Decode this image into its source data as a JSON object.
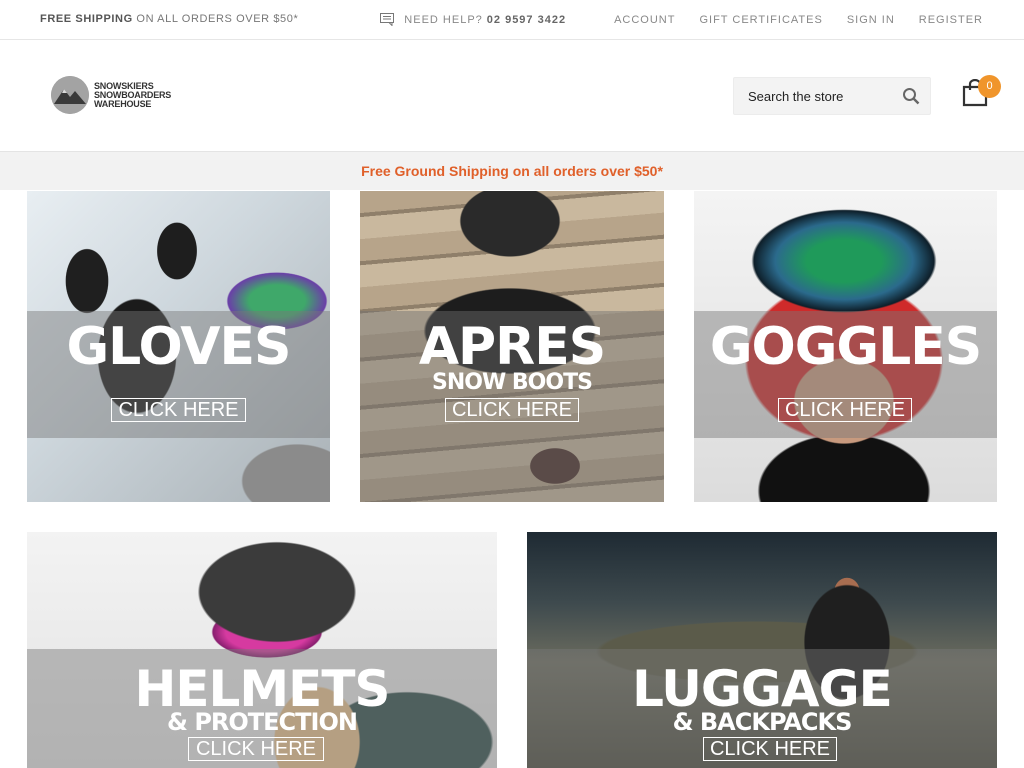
{
  "topbar": {
    "promo_bold": "FREE SHIPPING",
    "promo_rest": " ON ALL ORDERS OVER $50*",
    "help_label": "NEED HELP?",
    "help_phone": "02 9597 3422",
    "links": [
      "ACCOUNT",
      "GIFT CERTIFICATES",
      "SIGN IN",
      "REGISTER"
    ]
  },
  "header": {
    "logo_lines": [
      "SNOWSKIERS",
      "SNOWBOARDERS",
      "WAREHOUSE"
    ],
    "search_placeholder": "Search the store",
    "cart_count": "0"
  },
  "shipping_banner": "Free Ground Shipping on all orders over $50*",
  "tiles": [
    {
      "title": "GLOVES",
      "subtitle": "",
      "cta": "CLICK HERE"
    },
    {
      "title": "APRES",
      "subtitle": "SNOW BOOTS",
      "cta": "CLICK HERE"
    },
    {
      "title": "GOGGLES",
      "subtitle": "",
      "cta": "CLICK HERE"
    },
    {
      "title": "HELMETS",
      "subtitle": "& PROTECTION",
      "cta": "CLICK HERE"
    },
    {
      "title": "LUGGAGE",
      "subtitle": "& BACKPACKS",
      "cta": "CLICK HERE"
    }
  ],
  "colors": {
    "accent_orange": "#e0602a",
    "badge_orange": "#f0952b"
  },
  "icons": [
    "chat-icon",
    "search-icon",
    "shopping-bag-icon",
    "mountain-logo-icon"
  ]
}
